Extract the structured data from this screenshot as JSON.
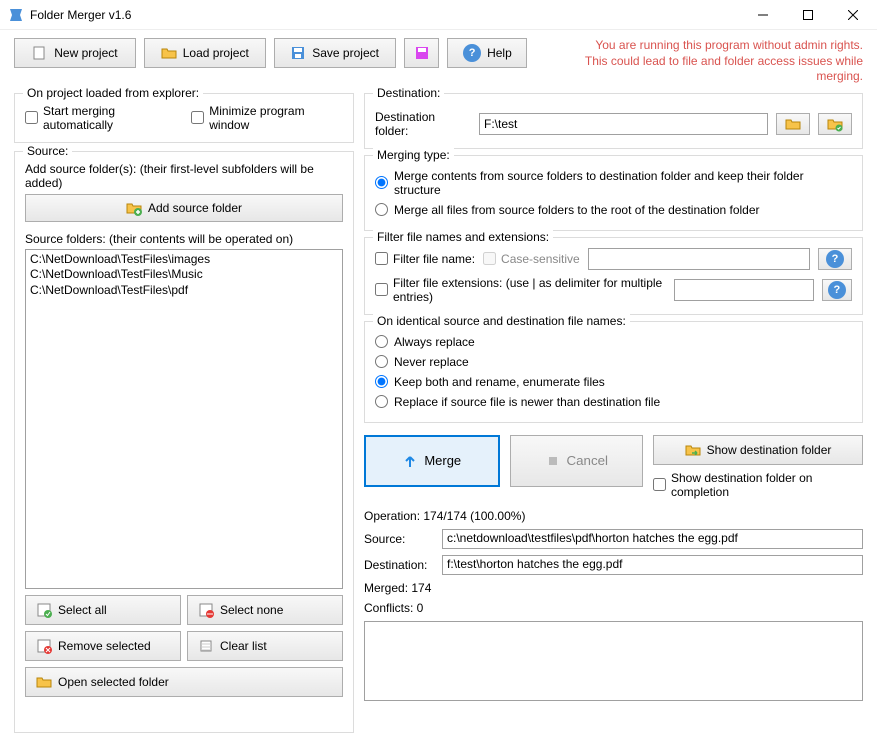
{
  "window": {
    "title": "Folder Merger v1.6"
  },
  "toolbar": {
    "new_project": "New project",
    "load_project": "Load project",
    "save_project": "Save project",
    "help": "Help"
  },
  "warning": {
    "line1": "You are running this program without admin rights.",
    "line2": "This could lead to file and folder access issues while merging."
  },
  "explorer": {
    "title": "On project loaded from explorer:",
    "start_auto": "Start merging automatically",
    "minimize": "Minimize program window"
  },
  "source": {
    "title": "Source:",
    "add_hint": "Add source folder(s): (their first-level subfolders will be added)",
    "add_btn": "Add source folder",
    "list_label": "Source folders: (their contents will be operated on)",
    "folders": [
      "C:\\NetDownload\\TestFiles\\images",
      "C:\\NetDownload\\TestFiles\\Music",
      "C:\\NetDownload\\TestFiles\\pdf"
    ],
    "select_all": "Select all",
    "select_none": "Select none",
    "remove_selected": "Remove selected",
    "clear_list": "Clear list",
    "open_selected": "Open selected folder"
  },
  "destination": {
    "title": "Destination:",
    "label": "Destination folder:",
    "value": "F:\\test"
  },
  "merging_type": {
    "title": "Merging type:",
    "opt1": "Merge contents from source folders to destination folder and keep their folder structure",
    "opt2": "Merge all files from source folders to the root of the destination folder"
  },
  "filter": {
    "title": "Filter file names and extensions:",
    "name": "Filter file name:",
    "case": "Case-sensitive",
    "ext": "Filter file extensions: (use | as delimiter for multiple entries)"
  },
  "identical": {
    "title": "On identical source and destination file names:",
    "opt1": "Always replace",
    "opt2": "Never replace",
    "opt3": "Keep both and rename, enumerate files",
    "opt4": "Replace if source file is newer than destination file"
  },
  "actions": {
    "merge": "Merge",
    "cancel": "Cancel",
    "show_dest": "Show destination folder",
    "show_on_complete": "Show destination folder on completion"
  },
  "status": {
    "operation": "Operation: 174/174 (100.00%)",
    "source_label": "Source:",
    "source_value": "c:\\netdownload\\testfiles\\pdf\\horton hatches the egg.pdf",
    "dest_label": "Destination:",
    "dest_value": "f:\\test\\horton hatches the egg.pdf",
    "merged": "Merged: 174",
    "conflicts": "Conflicts: 0"
  }
}
